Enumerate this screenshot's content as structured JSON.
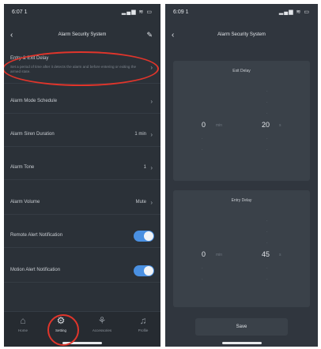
{
  "left": {
    "status_time": "6:07 1",
    "status_icons": "▂▄▆ ≋ ▭",
    "nav_title": "Alarm Security System",
    "rows": [
      {
        "label": "Entry & Exit Delay",
        "desc": "Set a period of time after it detects the alarm and before entering or exiting the armed state."
      },
      {
        "label": "Alarm Mode Schedule"
      },
      {
        "label": "Alarm Siren Duration",
        "value": "1 min"
      },
      {
        "label": "Alarm Tone",
        "value": "1"
      },
      {
        "label": "Alarm Volume",
        "value": "Mute"
      },
      {
        "label": "Remote Alert Notification"
      },
      {
        "label": "Motion Alert Notification"
      }
    ],
    "tabs": [
      {
        "label": "Home",
        "icon": "home-icon"
      },
      {
        "label": "Setting",
        "icon": "gear-icon"
      },
      {
        "label": "Accessories",
        "icon": "accessories-icon"
      },
      {
        "label": "Profile",
        "icon": "bell-icon"
      }
    ]
  },
  "right": {
    "status_time": "6:09 1",
    "status_icons": "▂▄▆ ≋ ▭",
    "nav_title": "Alarm Security System",
    "panels": [
      {
        "title": "Exit Delay",
        "minutes": "0",
        "min_unit": "min",
        "seconds": "20",
        "sec_unit": "s"
      },
      {
        "title": "Entry Delay",
        "minutes": "0",
        "min_unit": "min",
        "seconds": "45",
        "sec_unit": "s"
      }
    ],
    "save_label": "Save"
  },
  "colors": {
    "screen_bg": "#2b3138",
    "accent": "#4a90e2",
    "annotation": "#e0352b"
  }
}
